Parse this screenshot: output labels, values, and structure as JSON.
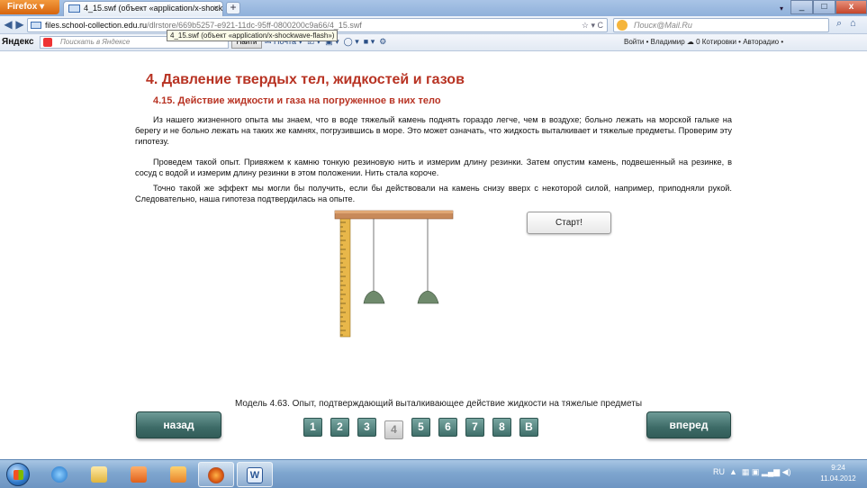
{
  "browser": {
    "app_button": "Firefox",
    "tab_title": "4_15.swf (объект «application/x-shockw...",
    "new_tab": "+",
    "url_host": "files.school-collection.edu.ru",
    "url_path": "/dlrstore/669b5257-e921-11dc-95ff-0800200c9a66/4_15.swf",
    "tooltip": "4_15.swf (объект «application/x-shockwave-flash»)",
    "search_placeholder": "Поиск@Mail.Ru",
    "yandex_logo": "Яндекс",
    "yandex_search_placeholder": "Поискать в Яндексе",
    "yandex_find": "Найти",
    "yandex_mail": "Почта",
    "toolbar_right": "Войти • Владимир  ☁ 0  Котировки •  Авторадио •"
  },
  "content": {
    "title": "4. Давление твердых тел, жидкостей и газов",
    "subtitle": "4.15. Действие жидкости и газа на погруженное в них тело",
    "paragraphs": [
      "Из нашего жизненного опыта мы знаем, что в воде тяжелый камень поднять гораздо легче, чем  в воздухе; больно лежать на морской гальке на берегу и не больно лежать на таких же камнях, погрузившись в море. Это может означать, что жидкость выталкивает и тяжелые предметы. Проверим эту гипотезу.",
      "Проведем такой опыт. Привяжем к камню тонкую резиновую нить и измерим длину резинки. Затем опустим камень, подвешенный на резинке, в сосуд с водой и измерим длину резинки в этом положении. Нить стала короче.",
      "Точно такой же эффект мы могли бы получить, если бы действовали на камень снизу вверх с некоторой силой, например, приподняли рукой. Следовательно, наша гипотеза подтвердилась на опыте."
    ],
    "start_button": "Старт!",
    "caption": "Модель 4.63. Опыт, подтверждающий выталкивающее действие жидкости на тяжелые предметы"
  },
  "nav": {
    "back": "назад",
    "forward": "вперед",
    "pages": [
      "1",
      "2",
      "3",
      "4",
      "5",
      "6",
      "7",
      "8",
      "B"
    ],
    "current_page": "4"
  },
  "taskbar": {
    "lang": "RU",
    "time": "9:24",
    "date": "11.04.2012"
  },
  "colors": {
    "heading": "#b83323",
    "nav_button": "#3d6b67",
    "ruler": "#e8b74a"
  }
}
